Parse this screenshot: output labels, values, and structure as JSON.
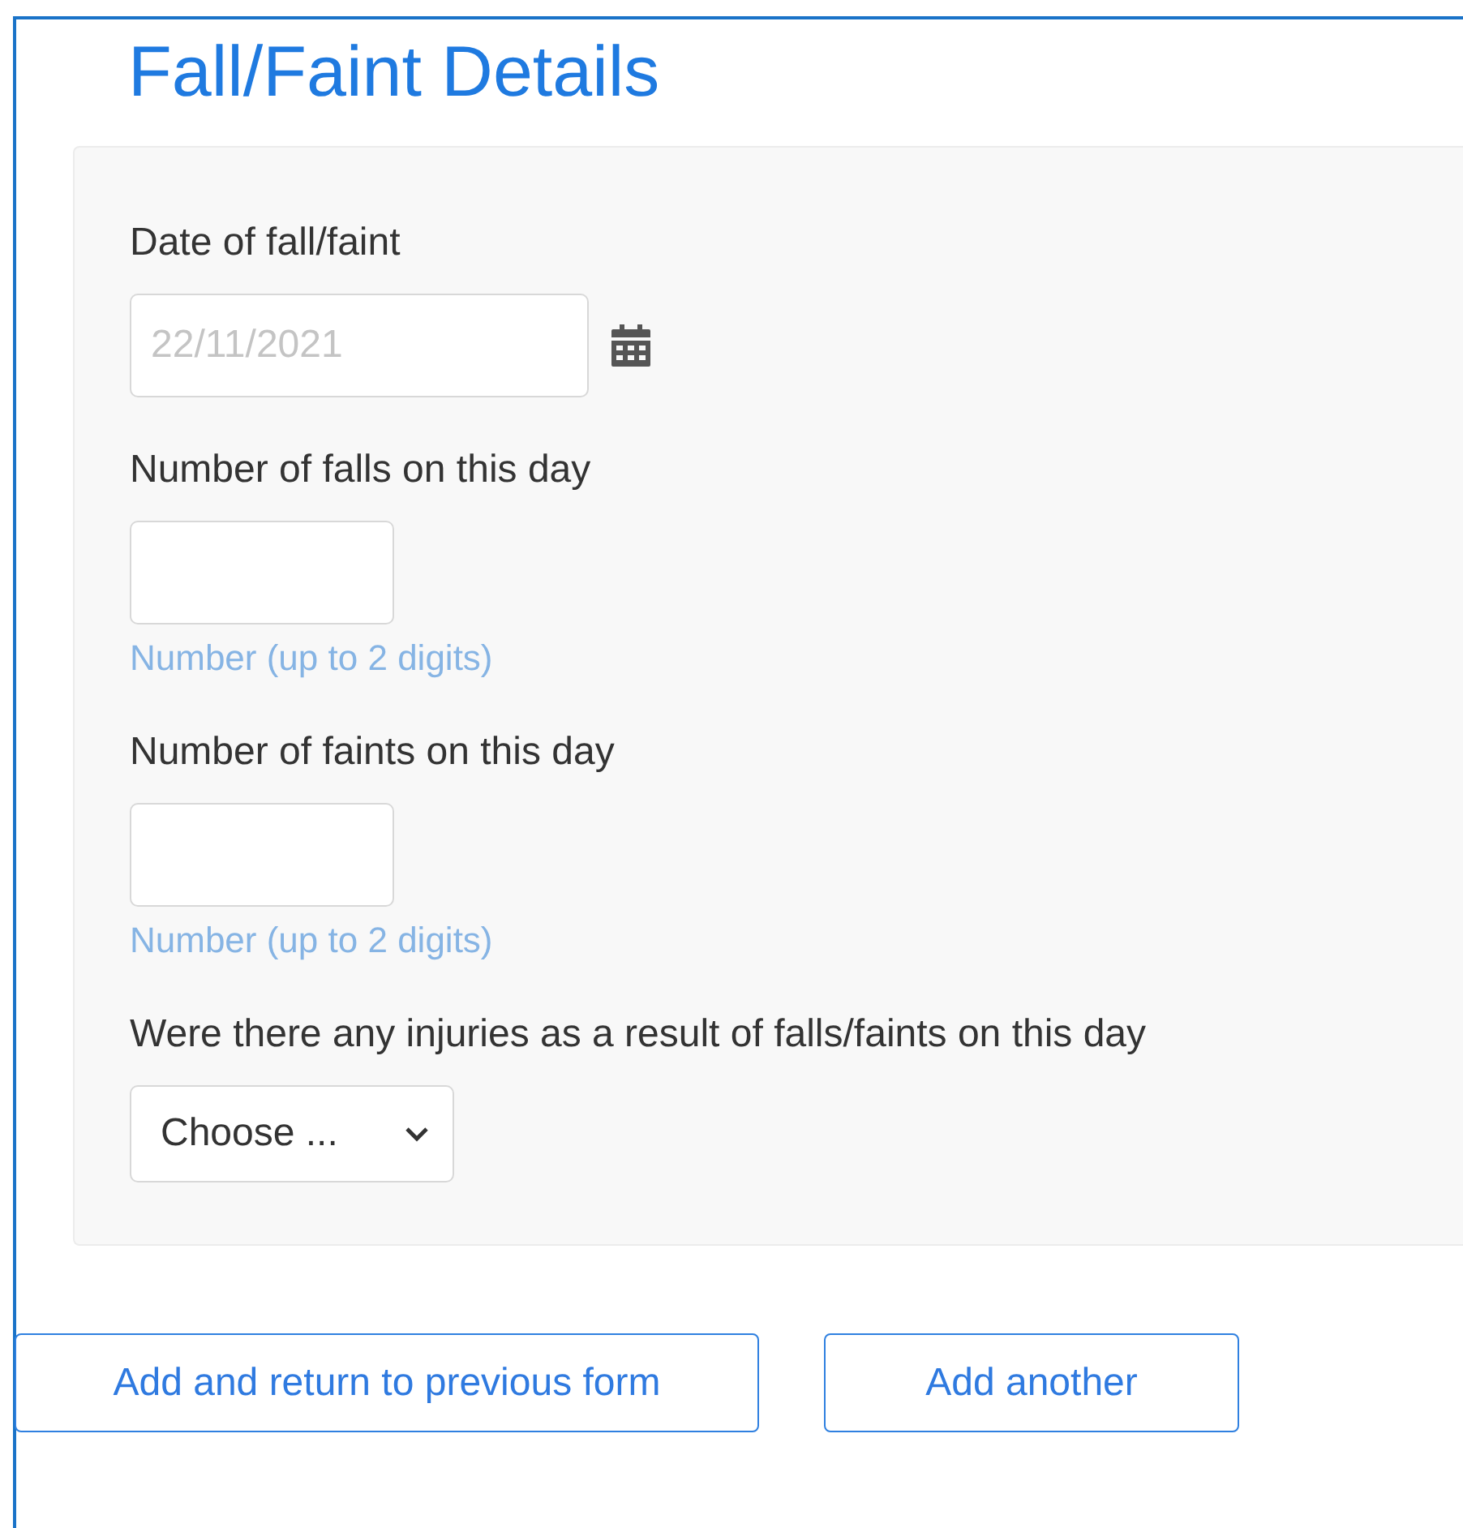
{
  "title": "Fall/Faint Details",
  "fields": [
    {
      "kind": "date",
      "label": "Date of fall/faint",
      "placeholder": "22/11/2021"
    },
    {
      "kind": "number",
      "label": "Number of falls on this day",
      "hint": "Number (up to 2 digits)"
    },
    {
      "kind": "number",
      "label": "Number of faints on this day",
      "hint": "Number (up to 2 digits)"
    },
    {
      "kind": "select",
      "label": "Were there any injuries as a result of falls/faints on this day",
      "value": "Choose ..."
    }
  ],
  "buttons": [
    "Add and return to previous form",
    "Add another"
  ]
}
